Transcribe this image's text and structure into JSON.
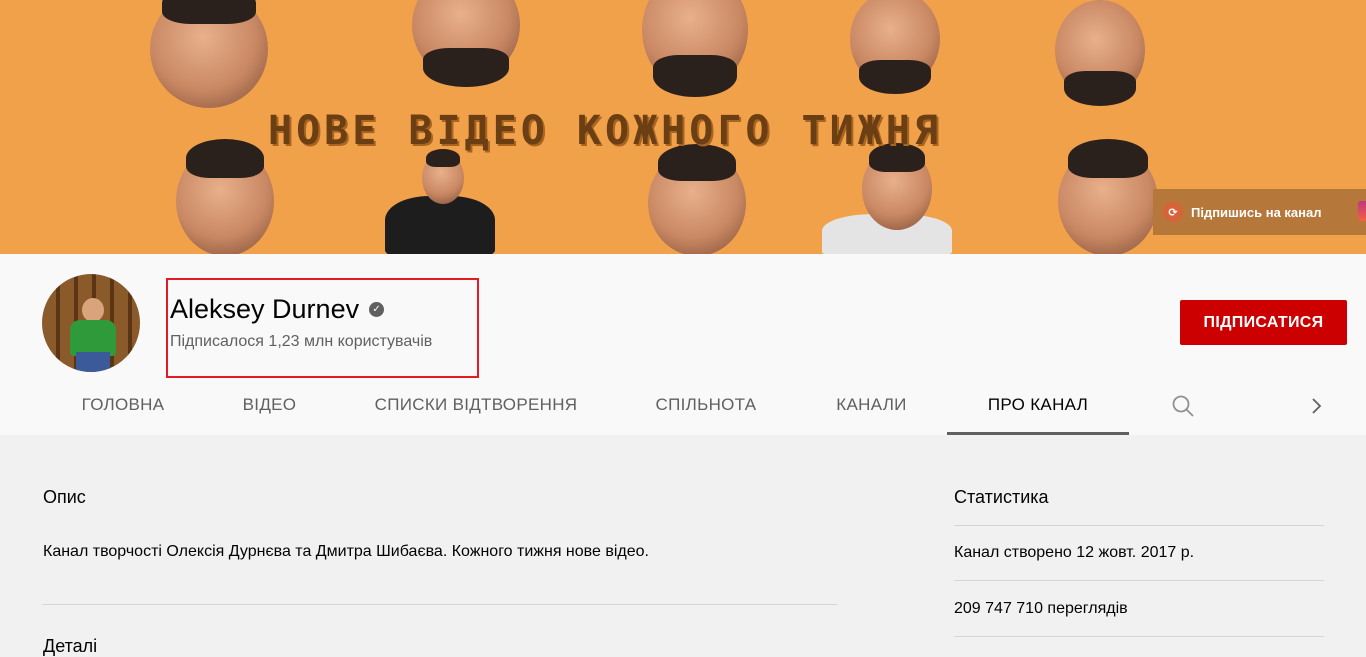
{
  "banner": {
    "text": "НОВЕ ВІДЕО КОЖНОГО ТИЖНЯ",
    "subscribe_link": "Підпишись на канал",
    "background_color": "#f2a14b"
  },
  "channel": {
    "name": "Aleksey Durnev",
    "verified_icon": "verified-check-icon",
    "subscribers": "Підписалося 1,23 млн користувачів",
    "subscribe_button": "ПІДПИСАТИСЯ",
    "accent_color": "#cc0000"
  },
  "tabs": [
    {
      "label": "ГОЛОВНА"
    },
    {
      "label": "ВІДЕО"
    },
    {
      "label": "СПИСКИ ВІДТВОРЕННЯ"
    },
    {
      "label": "СПІЛЬНОТА"
    },
    {
      "label": "КАНАЛИ"
    },
    {
      "label": "ПРО КАНАЛ",
      "active": true
    }
  ],
  "about": {
    "description_heading": "Опис",
    "description": "Канал творчості Олексія Дурнєва та Дмитра Шибаєва. Кожного тижня нове відео.",
    "details_heading": "Деталі",
    "stats_heading": "Статистика",
    "created": "Канал створено 12 жовт. 2017 р.",
    "views": "209 747 710 переглядів"
  }
}
